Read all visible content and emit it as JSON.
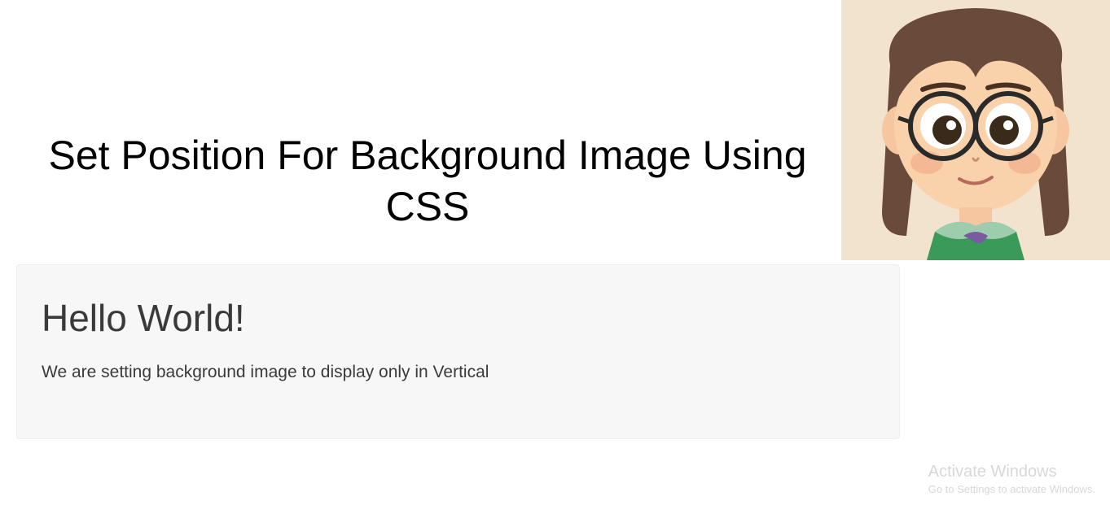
{
  "title": "Set Position For Background Image Using CSS",
  "box": {
    "heading": "Hello World!",
    "text": "We are setting background image to display only in Vertical"
  },
  "watermark": {
    "title": "Activate Windows",
    "subtitle": "Go to Settings to activate Windows."
  }
}
